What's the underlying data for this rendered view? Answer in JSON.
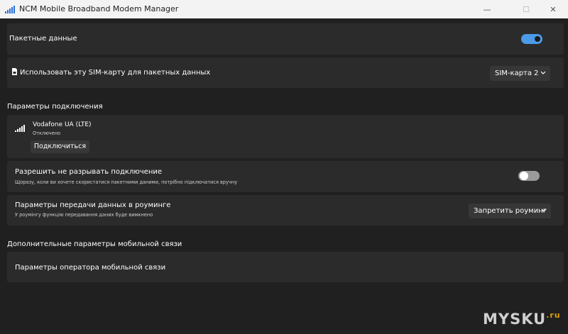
{
  "window": {
    "title": "NCM Mobile Broadband Modem Manager",
    "minimize": "—",
    "maximize": "☐",
    "close": "✕"
  },
  "packet_data": {
    "label": "Пакетные данные",
    "toggle_on": true
  },
  "sim": {
    "label": "Использовать эту SIM-карту для пакетных данных",
    "selected": "SIM-карта 2"
  },
  "connection_params": {
    "header": "Параметры подключения",
    "operator_name": "Vodafone UA (LTE)",
    "status": "Отключено",
    "connect_label": "Подключиться"
  },
  "keep_connection": {
    "label": "Разрешить не разрывать подключение",
    "desc": "Щоразу, коли ви хочете скористатися пакетними даними, потрібно підключатися вручну",
    "toggle_on": false
  },
  "roaming": {
    "label": "Параметры передачи данных в роуминге",
    "desc": "У роумінгу функцію передавання даних буде вимкнено",
    "selected": "Запретить роуминг"
  },
  "advanced": {
    "header": "Дополнительные параметры мобильной связи",
    "operator_settings_label": "Параметры оператора мобильной связи"
  },
  "watermark": {
    "text": "MYSKU",
    "suffix": ".ru"
  },
  "colors": {
    "accent": "#4c9be8",
    "background": "#202020",
    "card": "#2b2b2b"
  }
}
